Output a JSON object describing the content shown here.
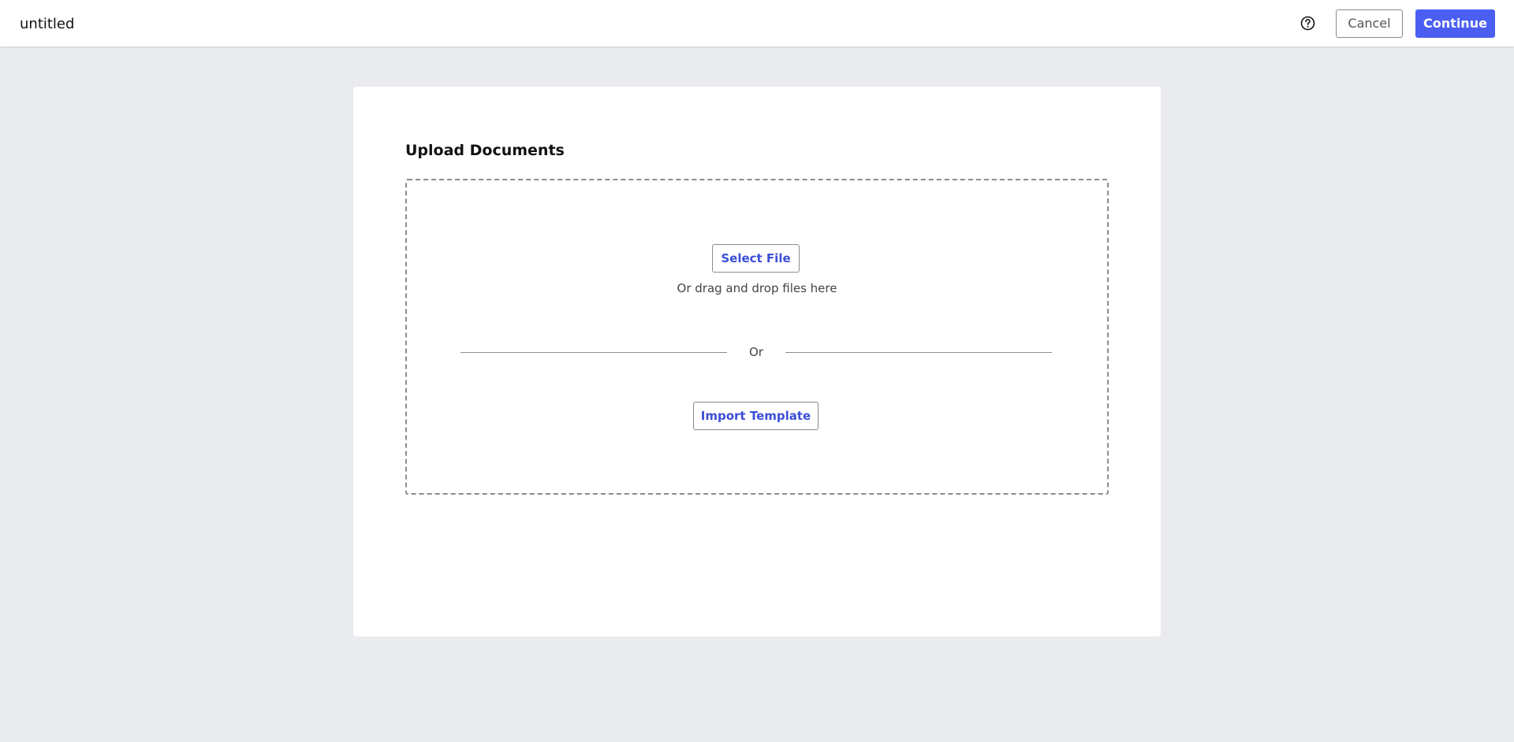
{
  "header": {
    "title": "untitled",
    "help_icon": "question-circle-icon",
    "cancel_label": "Cancel",
    "continue_label": "Continue"
  },
  "upload": {
    "title": "Upload Documents",
    "select_file_label": "Select File",
    "drag_drop_text": "Or drag and drop files here",
    "or_text": "Or",
    "import_template_label": "Import Template"
  },
  "colors": {
    "accent": "#4a5ff2",
    "link": "#3c4fd8",
    "background": "#eaebef"
  }
}
